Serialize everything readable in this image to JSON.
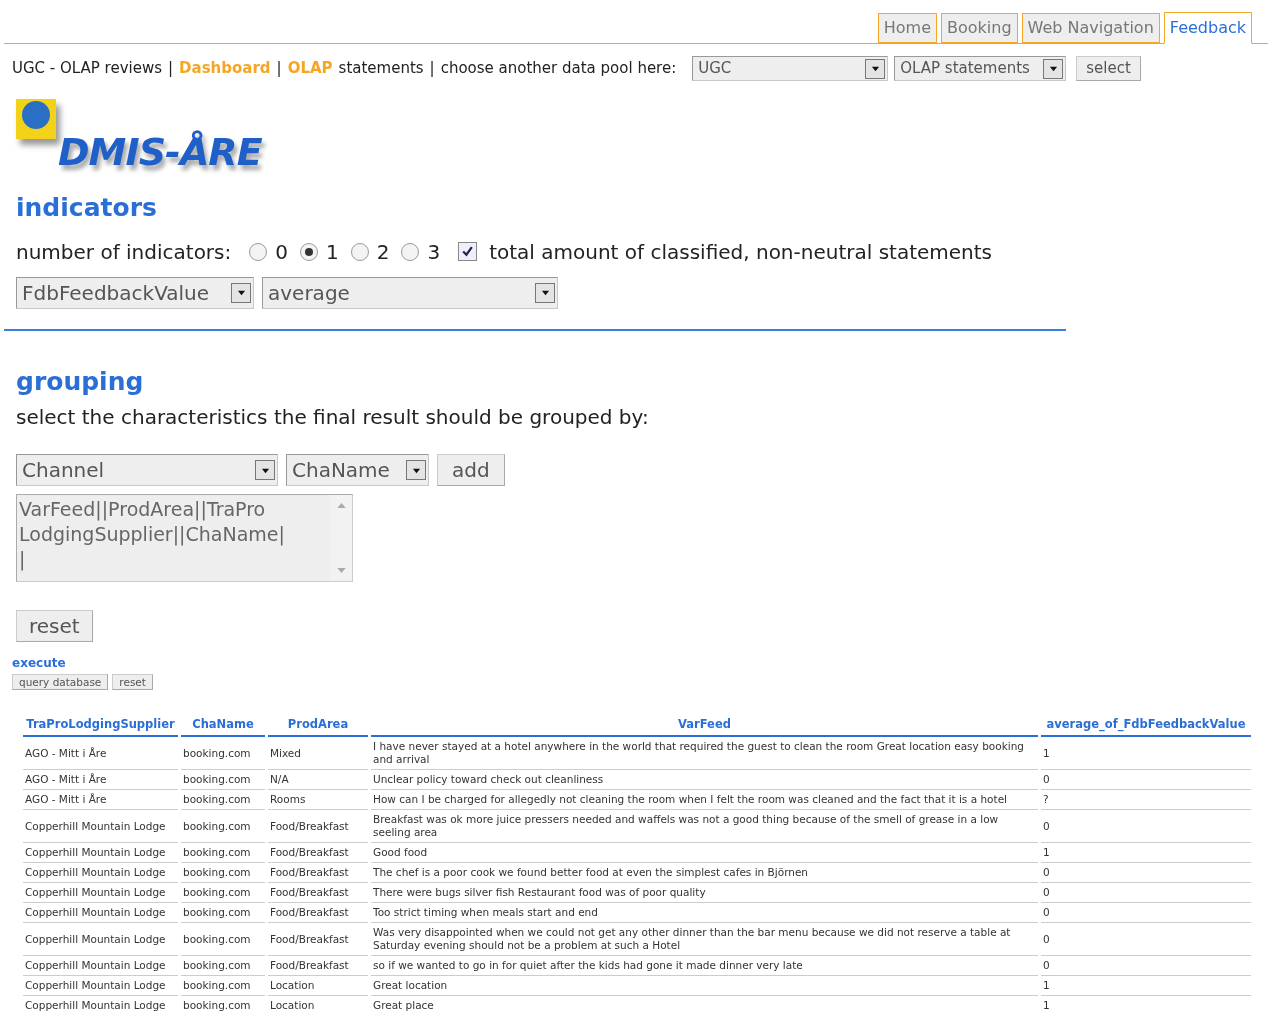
{
  "nav_tabs": [
    {
      "label": "Home",
      "selected": false
    },
    {
      "label": "Booking",
      "selected": false
    },
    {
      "label": "Web Navigation",
      "selected": false
    },
    {
      "label": "Feedback",
      "selected": true
    }
  ],
  "breadcrumb": [
    {
      "kind": "text",
      "text": "UGC - OLAP reviews"
    },
    {
      "kind": "separator",
      "text": "|"
    },
    {
      "kind": "link",
      "text": "Dashboard"
    },
    {
      "kind": "separator",
      "text": "|"
    },
    {
      "kind": "link",
      "text": "OLAP"
    },
    {
      "kind": "text",
      "text": "statements"
    },
    {
      "kind": "separator",
      "text": "|"
    },
    {
      "kind": "text",
      "text": "choose another data pool here:"
    }
  ],
  "data_pool": {
    "pool_select": "UGC",
    "view_select": "OLAP statements",
    "button": "select"
  },
  "logo": {
    "text": "DMIS-ÅRE"
  },
  "indicators": {
    "heading": "indicators",
    "count_label": "number of indicators:",
    "options": [
      {
        "label": "0",
        "selected": false
      },
      {
        "label": "1",
        "selected": true
      },
      {
        "label": "2",
        "selected": false
      },
      {
        "label": "3",
        "selected": false
      }
    ],
    "total_checkbox": {
      "label": "total amount of classified, non-neutral statements",
      "checked": true
    },
    "measure_select": "FdbFeedbackValue",
    "aggregate_select": "average"
  },
  "grouping": {
    "heading": "grouping",
    "instruction": "select the characteristics the final result should be grouped by:",
    "characteristic_select": "Channel",
    "attribute_select": "ChaName",
    "add_button": "add",
    "selected_list": [
      "VarFeed||ProdArea||TraPro",
      "LodgingSupplier||ChaName|",
      "|"
    ],
    "reset_button": "reset"
  },
  "execute": {
    "heading": "execute",
    "buttons": [
      "query database",
      "reset"
    ]
  },
  "table": {
    "columns": [
      "TraProLodgingSupplier",
      "ChaName",
      "ProdArea",
      "VarFeed",
      "average_of_FdbFeedbackValue"
    ],
    "rows": [
      [
        "AGO - Mitt i Åre",
        "booking.com",
        "Mixed",
        "I have never stayed at a hotel anywhere in the world that required the guest to clean the room Great location easy booking and arrival",
        "1"
      ],
      [
        "AGO - Mitt i Åre",
        "booking.com",
        "N/A",
        "Unclear policy toward check out cleanliness",
        "0"
      ],
      [
        "AGO - Mitt i Åre",
        "booking.com",
        "Rooms",
        "How can I be charged for allegedly not cleaning the room when I felt the room was cleaned and the fact that it is a hotel",
        "?"
      ],
      [
        "Copperhill Mountain Lodge",
        "booking.com",
        "Food/Breakfast",
        "Breakfast was ok more juice pressers needed and waffels was not a good thing because of the smell of grease in a low seeling area",
        "0"
      ],
      [
        "Copperhill Mountain Lodge",
        "booking.com",
        "Food/Breakfast",
        "Good food",
        "1"
      ],
      [
        "Copperhill Mountain Lodge",
        "booking.com",
        "Food/Breakfast",
        "The chef is a poor cook we found better food at even the simplest cafes in Björnen",
        "0"
      ],
      [
        "Copperhill Mountain Lodge",
        "booking.com",
        "Food/Breakfast",
        "There were bugs silver fish Restaurant food was of poor quality",
        "0"
      ],
      [
        "Copperhill Mountain Lodge",
        "booking.com",
        "Food/Breakfast",
        "Too strict timing when meals start and end",
        "0"
      ],
      [
        "Copperhill Mountain Lodge",
        "booking.com",
        "Food/Breakfast",
        "Was very disappointed when we could not get any other dinner than the bar menu because we did not reserve a table at Saturday evening should not be a problem at such a Hotel",
        "0"
      ],
      [
        "Copperhill Mountain Lodge",
        "booking.com",
        "Food/Breakfast",
        "so if we wanted to go in for quiet after the kids had gone it made dinner very late",
        "0"
      ],
      [
        "Copperhill Mountain Lodge",
        "booking.com",
        "Location",
        "Great location",
        "1"
      ],
      [
        "Copperhill Mountain Lodge",
        "booking.com",
        "Location",
        "Great place",
        "1"
      ]
    ]
  }
}
